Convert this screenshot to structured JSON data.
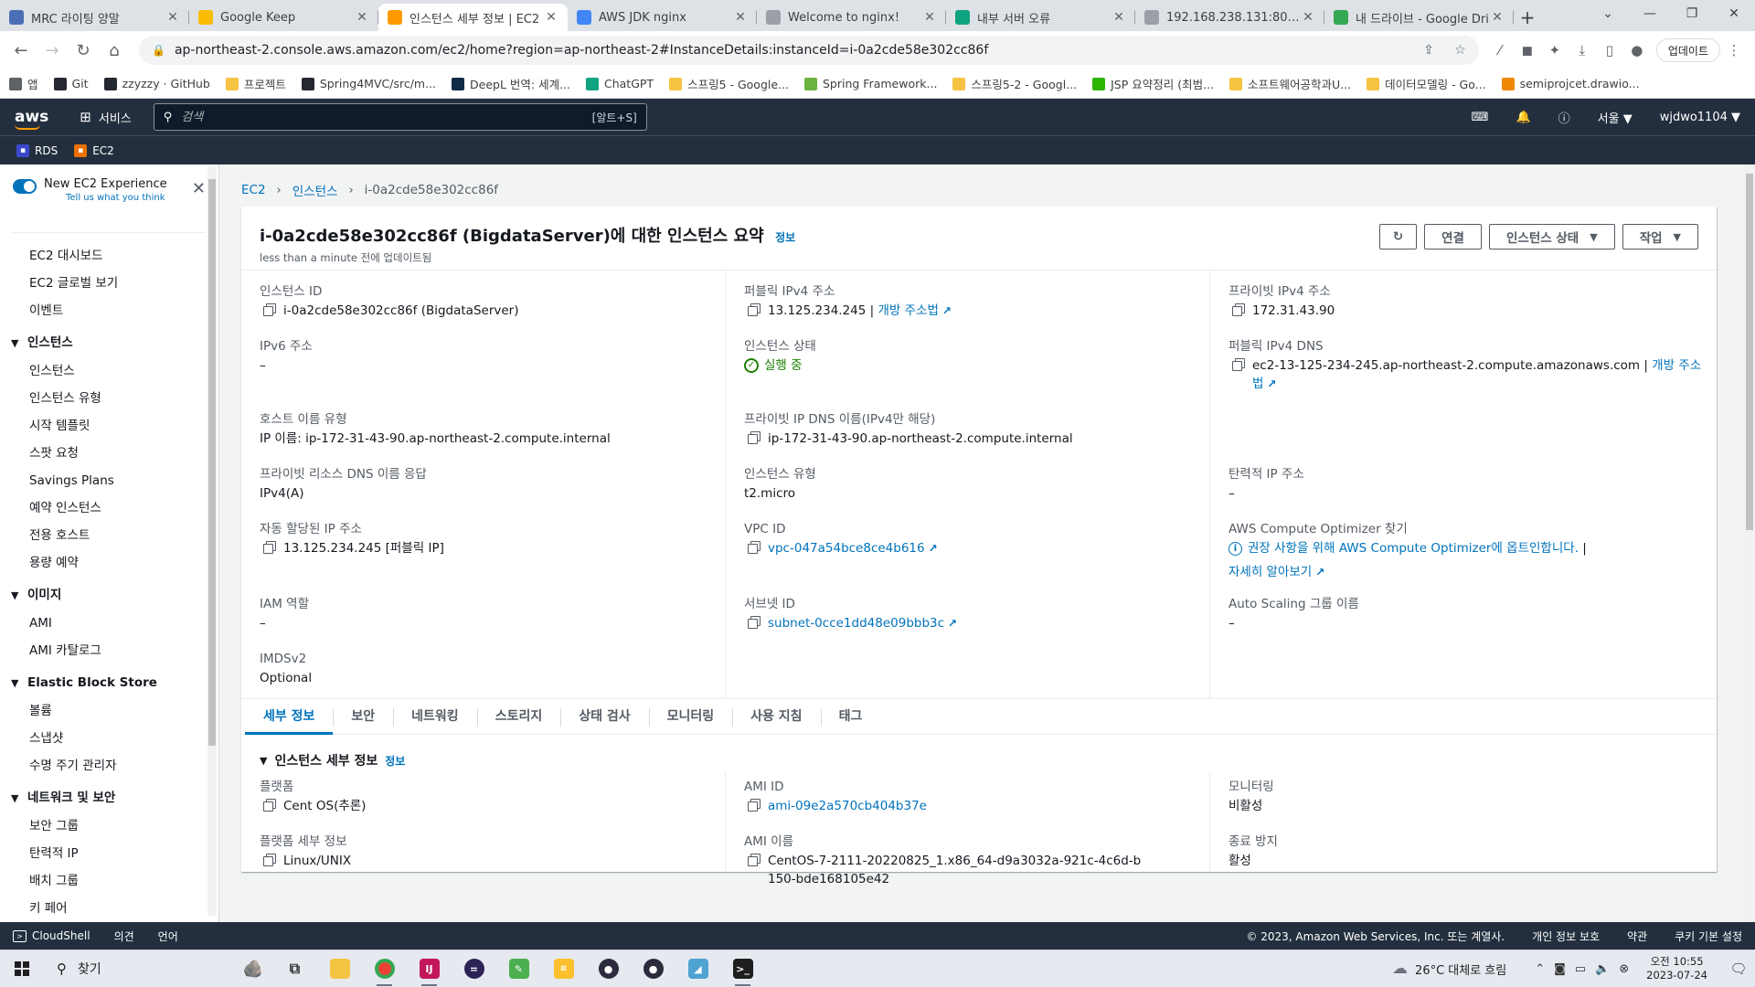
{
  "browser": {
    "tabs": [
      {
        "label": "MRC 라이팅 양말",
        "icon_color": "#4a6fb5",
        "active": false
      },
      {
        "label": "Google Keep",
        "icon_color": "#fbbc04",
        "active": false
      },
      {
        "label": "인스턴스 세부 정보 | EC2",
        "icon_color": "#ff9900",
        "active": true
      },
      {
        "label": "AWS JDK nginx",
        "icon_color": "#4285f4",
        "active": false
      },
      {
        "label": "Welcome to nginx!",
        "icon_color": "#9aa0a6",
        "active": false
      },
      {
        "label": "내부 서버 오류",
        "icon_color": "#10a37f",
        "active": false
      },
      {
        "label": "192.168.238.131:8080",
        "icon_color": "#9aa0a6",
        "active": false
      },
      {
        "label": "내 드라이브 - Google Dri",
        "icon_color": "#34a853",
        "active": false
      }
    ],
    "url": "ap-northeast-2.console.aws.amazon.com/ec2/home?region=ap-northeast-2#InstanceDetails:instanceId=i-0a2cde58e302cc86f",
    "update_label": "업데이트",
    "bookmarks": [
      {
        "label": "앱",
        "color": "#5f6368"
      },
      {
        "label": "Git",
        "color": "#24292f"
      },
      {
        "label": "zzyzzy · GitHub",
        "color": "#24292f"
      },
      {
        "label": "프로젝트",
        "color": "#f6c343"
      },
      {
        "label": "Spring4MVC/src/m...",
        "color": "#24292f"
      },
      {
        "label": "DeepL 번역: 세계...",
        "color": "#0f2b46"
      },
      {
        "label": "ChatGPT",
        "color": "#10a37f"
      },
      {
        "label": "스프링5 - Google...",
        "color": "#f6c343"
      },
      {
        "label": "Spring Framework...",
        "color": "#6db33f"
      },
      {
        "label": "스프링5-2 - Googl...",
        "color": "#f6c343"
      },
      {
        "label": "JSP 요약정리 (최범...",
        "color": "#2db400"
      },
      {
        "label": "소프트웨어공학과U...",
        "color": "#f6c343"
      },
      {
        "label": "데이터모델링 - Go...",
        "color": "#f6c343"
      },
      {
        "label": "semiprojcet.drawio...",
        "color": "#f08705"
      }
    ]
  },
  "aws_header": {
    "logo": "aws",
    "services_label": "서비스",
    "search_placeholder": "검색",
    "search_shortcut": "[알트+S]",
    "region": "서울 ▼",
    "user": "wjdwo1104 ▼",
    "favorites": [
      {
        "label": "RDS",
        "color": "#3b48cc"
      },
      {
        "label": "EC2",
        "color": "#ed7100"
      }
    ]
  },
  "sidebar": {
    "new_experience": "New EC2 Experience",
    "tell_us": "Tell us what you think",
    "top_items": [
      "EC2 대시보드",
      "EC2 글로벌 보기",
      "이벤트"
    ],
    "sections": [
      {
        "title": "인스턴스",
        "items": [
          "인스턴스",
          "인스턴스 유형",
          "시작 템플릿",
          "스팟 요청",
          "Savings Plans",
          "예약 인스턴스",
          "전용 호스트",
          "용량 예약"
        ]
      },
      {
        "title": "이미지",
        "items": [
          "AMI",
          "AMI 카탈로그"
        ]
      },
      {
        "title": "Elastic Block Store",
        "items": [
          "볼륨",
          "스냅샷",
          "수명 주기 관리자"
        ]
      },
      {
        "title": "네트워크 및 보안",
        "items": [
          "보안 그룹",
          "탄력적 IP",
          "배치 그룹",
          "키 페어"
        ]
      }
    ]
  },
  "breadcrumb": {
    "ec2": "EC2",
    "instances": "인스턴스",
    "current": "i-0a2cde58e302cc86f"
  },
  "summary": {
    "title": "i-0a2cde58e302cc86f (BigdataServer)에 대한 인스턴스 요약",
    "info": "정보",
    "updated": "less than a minute 전에 업데이트됨",
    "actions": {
      "refresh": "↻",
      "connect": "연결",
      "instance_state": "인스턴스 상태",
      "actions": "작업"
    },
    "instance_id": {
      "label": "인스턴스 ID",
      "value": "i-0a2cde58e302cc86f (BigdataServer)"
    },
    "ipv6": {
      "label": "IPv6 주소",
      "value": "–"
    },
    "hostname_type": {
      "label": "호스트 이름 유형",
      "value": "IP 이름: ip-172-31-43-90.ap-northeast-2.compute.internal"
    },
    "private_dns_answer": {
      "label": "프라이빗 리소스 DNS 이름 응답",
      "value": "IPv4(A)"
    },
    "auto_ip": {
      "label": "자동 할당된 IP 주소",
      "value": "13.125.234.245 [퍼블릭 IP]"
    },
    "iam_role": {
      "label": "IAM 역할",
      "value": "–"
    },
    "imdsv2": {
      "label": "IMDSv2",
      "value": "Optional"
    },
    "public_ipv4": {
      "label": "퍼블릭 IPv4 주소",
      "value": "13.125.234.245 |",
      "link": "개방 주소법"
    },
    "state": {
      "label": "인스턴스 상태",
      "value": "실행 중"
    },
    "private_dns_name": {
      "label": "프라이빗 IP DNS 이름(IPv4만 해당)",
      "value": "ip-172-31-43-90.ap-northeast-2.compute.internal"
    },
    "instance_type": {
      "label": "인스턴스 유형",
      "value": "t2.micro"
    },
    "vpc_id": {
      "label": "VPC ID",
      "value": "vpc-047a54bce8ce4b616"
    },
    "subnet_id": {
      "label": "서브넷 ID",
      "value": "subnet-0cce1dd48e09bbb3c"
    },
    "private_ipv4": {
      "label": "프라이빗 IPv4 주소",
      "value": "172.31.43.90"
    },
    "public_dns": {
      "label": "퍼블릭 IPv4 DNS",
      "value": "ec2-13-125-234-245.ap-northeast-2.compute.amazonaws.com |",
      "link_a": "개방 주소",
      "link_b": "법"
    },
    "elastic_ip": {
      "label": "탄력적 IP 주소",
      "value": "–"
    },
    "optimizer": {
      "label": "AWS Compute Optimizer 찾기",
      "link": "권장 사항을 위해 AWS Compute Optimizer에 옵트인합니다.",
      "sep": "|",
      "learn": "자세히 알아보기"
    },
    "auto_scaling": {
      "label": "Auto Scaling 그룹 이름",
      "value": "–"
    }
  },
  "detail_tabs": [
    "세부 정보",
    "보안",
    "네트워킹",
    "스토리지",
    "상태 검사",
    "모니터링",
    "사용 지침",
    "태그"
  ],
  "details": {
    "heading": "인스턴스 세부 정보",
    "info": "정보",
    "platform": {
      "label": "플랫폼",
      "value": "Cent OS(추론)"
    },
    "platform_details": {
      "label": "플랫폼 세부 정보",
      "value": "Linux/UNIX"
    },
    "ami_id": {
      "label": "AMI ID",
      "value": "ami-09e2a570cb404b37e"
    },
    "ami_name": {
      "label": "AMI 이름",
      "value": "CentOS-7-2111-20220825_1.x86_64-d9a3032a-921c-4c6d-b150-bde168105e42"
    },
    "monitoring": {
      "label": "모니터링",
      "value": "비활성"
    },
    "termination": {
      "label": "종료 방지",
      "value": "활성"
    }
  },
  "footer": {
    "cloudshell": "CloudShell",
    "feedback": "의견",
    "language": "언어",
    "copyright": "© 2023, Amazon Web Services, Inc. 또는 계열사.",
    "privacy": "개인 정보 보호",
    "terms": "약관",
    "cookies": "쿠키 기본 설정"
  },
  "taskbar": {
    "search": "찾기",
    "weather": "26°C 대체로 흐림",
    "time": "오전 10:55",
    "date": "2023-07-24"
  }
}
